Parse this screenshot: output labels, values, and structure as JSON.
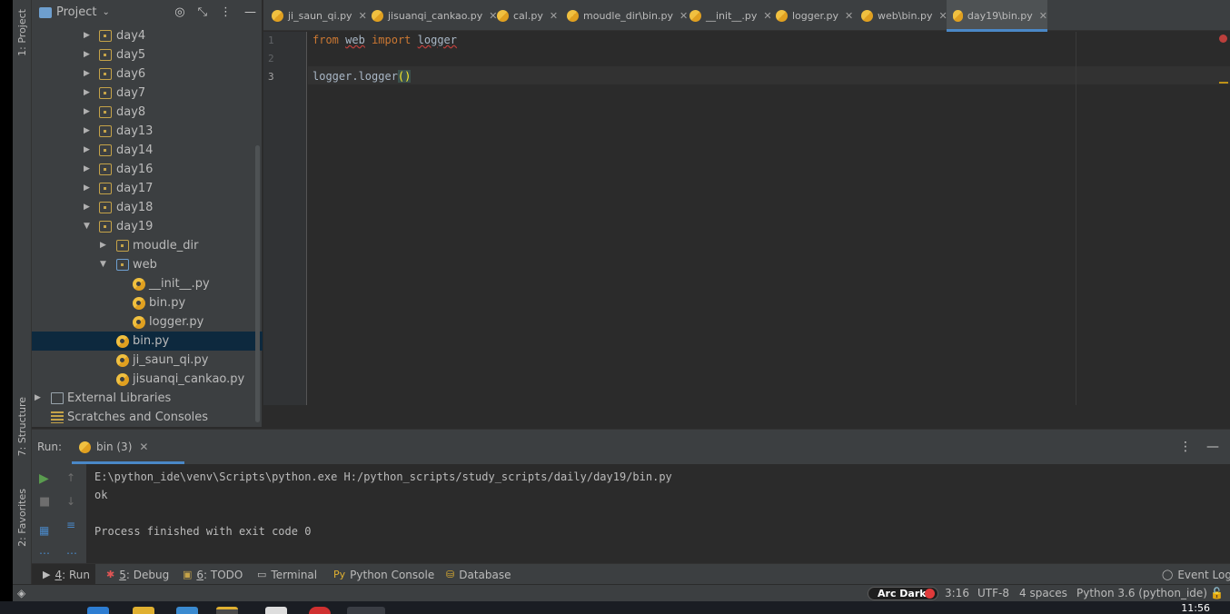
{
  "sidebar": {
    "project_tab": "1: Project",
    "structure_tab": "7: Structure",
    "favorites_tab": "2: Favorites"
  },
  "project": {
    "title": "Project",
    "icons": [
      "target-icon",
      "collapse-icon",
      "more-icon",
      "minimize-icon"
    ],
    "tree": [
      {
        "label": "day4",
        "type": "folder",
        "expanded": false
      },
      {
        "label": "day5",
        "type": "folder",
        "expanded": false
      },
      {
        "label": "day6",
        "type": "folder",
        "expanded": false
      },
      {
        "label": "day7",
        "type": "folder",
        "expanded": false
      },
      {
        "label": "day8",
        "type": "folder",
        "expanded": false
      },
      {
        "label": "day13",
        "type": "folder",
        "expanded": false
      },
      {
        "label": "day14",
        "type": "folder",
        "expanded": false
      },
      {
        "label": "day16",
        "type": "folder",
        "expanded": false
      },
      {
        "label": "day17",
        "type": "folder",
        "expanded": false
      },
      {
        "label": "day18",
        "type": "folder",
        "expanded": false
      },
      {
        "label": "day19",
        "type": "folder",
        "expanded": true
      },
      {
        "label": "moudle_dir",
        "type": "folder",
        "expanded": false
      },
      {
        "label": "web",
        "type": "package",
        "expanded": true
      },
      {
        "label": "__init__.py",
        "type": "python-file"
      },
      {
        "label": "bin.py",
        "type": "python-file"
      },
      {
        "label": "logger.py",
        "type": "python-file"
      },
      {
        "label": "bin.py",
        "type": "python-file",
        "selected": true
      },
      {
        "label": "ji_saun_qi.py",
        "type": "python-file"
      },
      {
        "label": "jisuanqi_cankao.py",
        "type": "python-file"
      },
      {
        "label": "External Libraries",
        "type": "library"
      },
      {
        "label": "Scratches and Consoles",
        "type": "scratches"
      }
    ]
  },
  "tabs": [
    {
      "label": "ji_saun_qi.py"
    },
    {
      "label": "jisuanqi_cankao.py"
    },
    {
      "label": "cal.py"
    },
    {
      "label": "moudle_dir\\bin.py"
    },
    {
      "label": "__init__.py"
    },
    {
      "label": "logger.py"
    },
    {
      "label": "web\\bin.py"
    },
    {
      "label": "day19\\bin.py",
      "active": true
    }
  ],
  "editor": {
    "line_numbers": [
      "1",
      "2",
      "3"
    ],
    "line1": {
      "kw_from": "from",
      "module": "web",
      "kw_import": "import",
      "name": "logger"
    },
    "line3": {
      "call": "logger.logger",
      "parens": "()"
    }
  },
  "run": {
    "label": "Run:",
    "tab_label": "bin (3)",
    "output": [
      "E:\\python_ide\\venv\\Scripts\\python.exe H:/python_scripts/study_scripts/daily/day19/bin.py",
      "ok",
      "",
      "Process finished with exit code 0"
    ]
  },
  "tool_tabs": {
    "run": {
      "num": "4",
      "label": ": Run"
    },
    "debug": {
      "num": "5",
      "label": ": Debug"
    },
    "todo": {
      "num": "6",
      "label": ": TODO"
    },
    "terminal": "Terminal",
    "python_console": "Python Console",
    "database": "Database",
    "event_log": "Event Log"
  },
  "status": {
    "theme": "Arc Dark",
    "position": "3:16",
    "encoding": "UTF-8",
    "indent": "4 spaces",
    "interpreter": "Python 3.6 (python_ide)"
  },
  "taskbar": {
    "clock": "11:56"
  }
}
